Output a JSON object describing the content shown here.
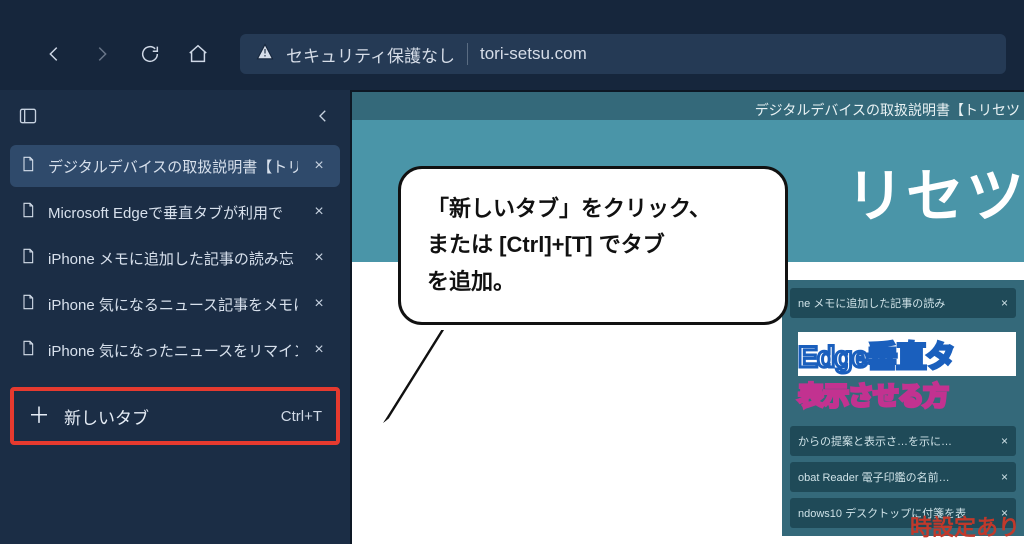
{
  "toolbar": {
    "security_label": "セキュリティ保護なし",
    "domain": "tori-setsu.com"
  },
  "sidebar": {
    "tabs": [
      {
        "title": "デジタルデバイスの取扱説明書【トリセ",
        "active": true
      },
      {
        "title": "Microsoft Edgeで垂直タブが利用で",
        "active": false
      },
      {
        "title": "iPhone メモに追加した記事の読み忘",
        "active": false
      },
      {
        "title": "iPhone 気になるニュース記事をメモに",
        "active": false
      },
      {
        "title": "iPhone 気になったニュースをリマインダ",
        "active": false
      }
    ],
    "new_tab": {
      "label": "新しいタブ",
      "shortcut": "Ctrl+T"
    }
  },
  "callout": {
    "line1": "「新しいタブ」をクリック、",
    "line2": "または [Ctrl]+[T] でタブ",
    "line3": "を追加。"
  },
  "page": {
    "tagline": "デジタルデバイスの取扱説明書【トリセツ",
    "hero_title_fragment": "リセツ",
    "widget": {
      "rows": [
        "ne メモに追加した記事の読み",
        "からの提案と表示さ…を示に…",
        "obat Reader 電子印鑑の名前…",
        "ndows10 デスクトップに付箋を表"
      ]
    },
    "art": {
      "line1a": "Edge",
      "line1b": "垂直タ",
      "line2": "表示させる方"
    },
    "bottom_fragment": "時設定あり"
  }
}
